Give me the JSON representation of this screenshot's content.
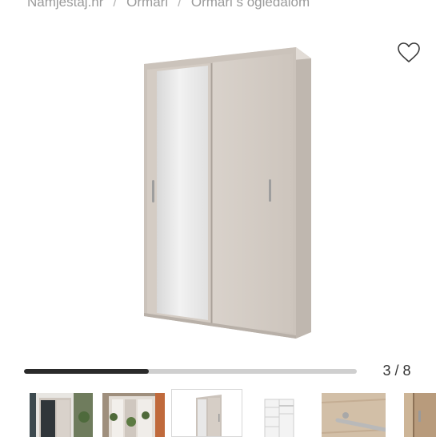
{
  "breadcrumb": {
    "items": [
      "Namještaj.hr",
      "Ormari",
      "Ormari s ogledalom"
    ],
    "separator": "/"
  },
  "favorite": {
    "icon": "heart-outline-icon"
  },
  "product_image": {
    "alt": ""
  },
  "gallery": {
    "current": 3,
    "total": 8,
    "counter_text": "3 / 8",
    "progress": 0.375,
    "thumbnails": [
      {
        "icon": "wardrobe-room-photo"
      },
      {
        "icon": "wardrobe-open-room-photo"
      },
      {
        "icon": "wardrobe-mirror-photo"
      },
      {
        "icon": "wardrobe-shelves-photo"
      },
      {
        "icon": "hanging-rail-photo"
      },
      {
        "icon": "wood-detail-photo"
      }
    ]
  },
  "colors": {
    "wardrobe": "#cfc7bf",
    "progress": "#2a2a2a",
    "track": "#cfcfcf"
  }
}
